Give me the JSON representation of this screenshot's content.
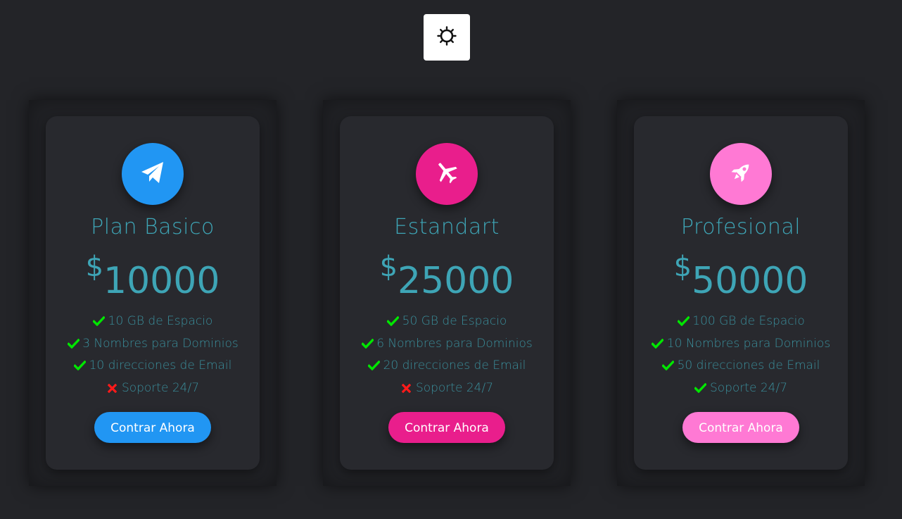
{
  "theme_toggle": {
    "icon": "sun-icon"
  },
  "plans": [
    {
      "name": "Plan Basico",
      "currency": "$",
      "price": "10000",
      "accent": "#2196f3",
      "icon": "paper-plane-icon",
      "features": [
        {
          "text": "10 GB de Espacio",
          "included": true
        },
        {
          "text": "3 Nombres para Dominios",
          "included": true
        },
        {
          "text": "10 direcciones de Email",
          "included": true
        },
        {
          "text": "Soporte 24/7",
          "included": false
        }
      ],
      "button": "Contrar Ahora"
    },
    {
      "name": "Estandart",
      "currency": "$",
      "price": "25000",
      "accent": "#e91e8c",
      "icon": "airplane-icon",
      "features": [
        {
          "text": "50 GB de Espacio",
          "included": true
        },
        {
          "text": "6 Nombres para Dominios",
          "included": true
        },
        {
          "text": "20 direcciones de Email",
          "included": true
        },
        {
          "text": "Soporte 24/7",
          "included": false
        }
      ],
      "button": "Contrar Ahora"
    },
    {
      "name": "Profesional",
      "currency": "$",
      "price": "50000",
      "accent": "#ff79d4",
      "icon": "rocket-icon",
      "features": [
        {
          "text": "100 GB de Espacio",
          "included": true
        },
        {
          "text": "10 Nombres para Dominios",
          "included": true
        },
        {
          "text": "50 direcciones de Email",
          "included": true
        },
        {
          "text": "Soporte 24/7",
          "included": true
        }
      ],
      "button": "Contrar Ahora"
    }
  ],
  "colors": {
    "check": "#00e600",
    "cross": "#ff1a1a",
    "text": "#3ea5b6",
    "background": "#232428"
  }
}
